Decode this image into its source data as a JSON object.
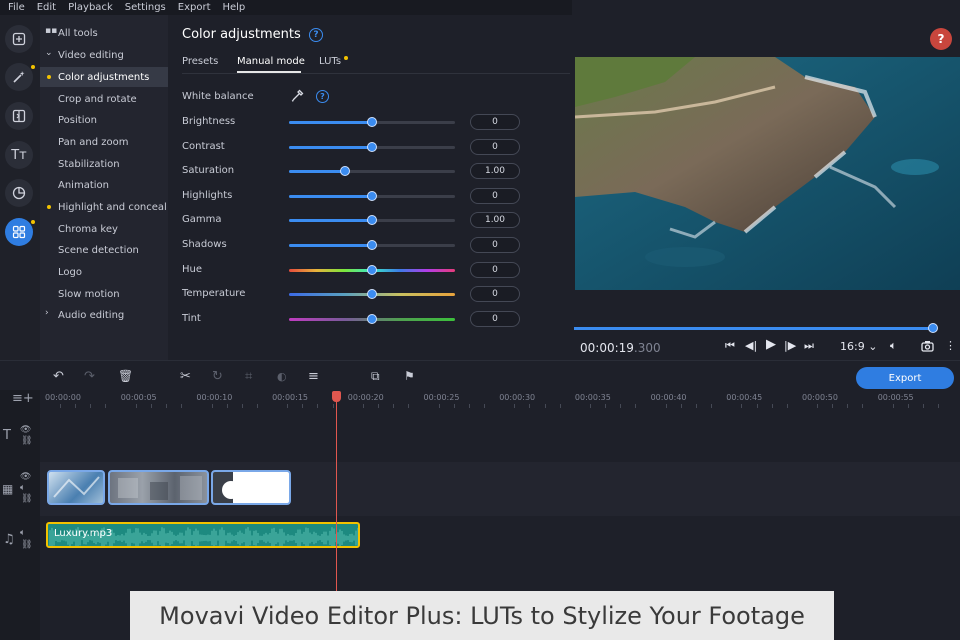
{
  "menu": [
    "File",
    "Edit",
    "Playback",
    "Settings",
    "Export",
    "Help"
  ],
  "tools": {
    "items": [
      {
        "label": "All tools"
      },
      {
        "label": "Video editing"
      },
      {
        "label": "Color adjustments"
      },
      {
        "label": "Crop and rotate"
      },
      {
        "label": "Position"
      },
      {
        "label": "Pan and zoom"
      },
      {
        "label": "Stabilization"
      },
      {
        "label": "Animation"
      },
      {
        "label": "Highlight and conceal"
      },
      {
        "label": "Chroma key"
      },
      {
        "label": "Scene detection"
      },
      {
        "label": "Logo"
      },
      {
        "label": "Slow motion"
      },
      {
        "label": "Audio editing"
      }
    ]
  },
  "panel": {
    "title": "Color adjustments",
    "tabs": [
      "Presets",
      "Manual mode",
      "LUTs"
    ],
    "white_balance_label": "White balance",
    "sliders": [
      {
        "label": "Brightness",
        "value": "0",
        "level": 0.5
      },
      {
        "label": "Contrast",
        "value": "0",
        "level": 0.5
      },
      {
        "label": "Saturation",
        "value": "1.00",
        "level": 0.34
      },
      {
        "label": "Highlights",
        "value": "0",
        "level": 0.5
      },
      {
        "label": "Gamma",
        "value": "1.00",
        "level": 0.5
      },
      {
        "label": "Shadows",
        "value": "0",
        "level": 0.5
      },
      {
        "label": "Hue",
        "value": "0",
        "level": 0.5
      },
      {
        "label": "Temperature",
        "value": "0",
        "level": 0.5
      },
      {
        "label": "Tint",
        "value": "0",
        "level": 0.5
      }
    ]
  },
  "preview": {
    "timecode": "00:00:19",
    "timecode_ms": ".300",
    "aspect_ratio": "16:9",
    "progress": 1.0
  },
  "timeline": {
    "export_label": "Export",
    "ticks": [
      "00:00:00",
      "00:00:05",
      "00:00:10",
      "00:00:15",
      "00:00:20",
      "00:00:25",
      "00:00:30",
      "00:00:35",
      "00:00:40",
      "00:00:45",
      "00:00:50",
      "00:00:55"
    ],
    "audio_clip_name": "Luxury.mp3"
  },
  "caption": "Movavi Video Editor Plus: LUTs to Stylize Your Footage"
}
